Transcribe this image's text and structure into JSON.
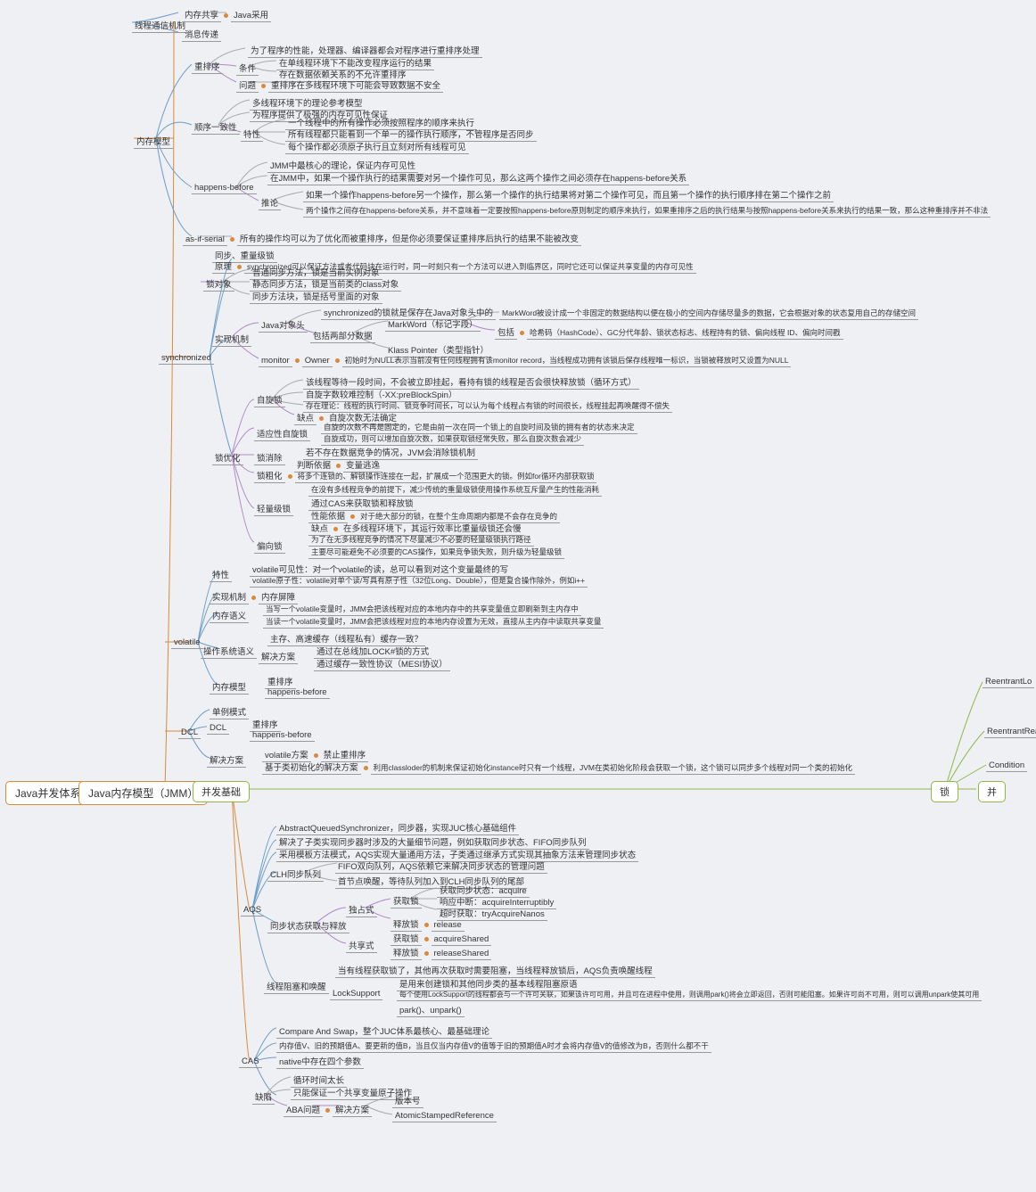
{
  "root": "Java并发体系",
  "jmm": "Java内存模型（JMM）",
  "basic": "并发基础",
  "lock": "锁",
  "tool": "并",
  "reentrant": "ReentrantLo",
  "reentrantRW": "ReentrantRea",
  "condition": "Condition",
  "comm_mech": "线程通信机制",
  "comm_shared": "内存共享",
  "comm_java": "Java采用",
  "comm_msg": "消息传递",
  "mem_model": "内存模型",
  "reorder": "重排序",
  "reorder_desc": "为了程序的性能，处理器、编译器都会对程序进行重排序处理",
  "reorder_cond": "条件",
  "reorder_c1": "在单线程环境下不能改变程序运行的结果",
  "reorder_c2": "存在数据依赖关系的不允许重排序",
  "reorder_prob": "问题",
  "reorder_p1": "重排序在多线程环境下可能会导致数据不安全",
  "seq_consist": "顺序一致性",
  "seq_desc": "多线程环境下的理论参考模型",
  "seq_guarantee": "为程序提供了极强的内存可见性保证",
  "seq_feat": "特性",
  "seq_f1": "一个线程中的所有操作必须按照程序的顺序来执行",
  "seq_f2": "所有线程都只能看到一个单一的操作执行顺序，不管程序是否同步",
  "seq_f3": "每个操作都必须原子执行且立刻对所有线程可见",
  "hb": "happens-before",
  "hb_desc": "JMM中最核心的理论，保证内存可见性",
  "hb_def": "在JMM中，如果一个操作执行的结果需要对另一个操作可见，那么这两个操作之间必须存在happens-before关系",
  "hb_infer": "推论",
  "hb_i1": "如果一个操作happens-before另一个操作，那么第一个操作的执行结果将对第二个操作可见，而且第一个操作的执行顺序排在第二个操作之前",
  "hb_i2": "两个操作之间存在happens-before关系，并不意味着一定要按照happens-before原则制定的顺序来执行，如果重排序之后的执行结果与按照happens-before关系来执行的结果一致，那么这种重排序并不非法",
  "asif": "as-if-serial",
  "asif_desc": "所有的操作均可以为了优化而被重排序，但是你必须要保证重排序后执行的结果不能被改变",
  "sync": "synchronized",
  "sync_level": "同步、重量级锁",
  "sync_princ": "原理",
  "sync_princ_desc": "synchronized可以保证方法或者代码块在运行时，同一时刻只有一个方法可以进入到临界区，同时它还可以保证共享变量的内存可见性",
  "lock_obj": "锁对象",
  "lock_o1": "普通同步方法，锁是当前实例对象",
  "lock_o2": "静态同步方法，锁是当前类的class对象",
  "lock_o3": "同步方法块，锁是括号里面的对象",
  "impl_mech": "实现机制",
  "java_header": "Java对象头",
  "header_desc": "synchronized的锁就是保存在Java对象头中的",
  "header_parts": "包括两部分数据",
  "markword": "MarkWord（标记字段）",
  "mw_desc": "MarkWord被设计成一个非固定的数据结构以便在极小的空间内存储尽量多的数据，它会根据对象的状态复用自己的存储空间",
  "mw_include": "包括",
  "mw_i1": "哈希码（HashCode）、GC分代年龄、锁状态标志、线程持有的锁、偏向线程 ID、偏向时间戳",
  "klass": "Klass Pointer（类型指针）",
  "monitor": "monitor",
  "owner": "Owner",
  "owner_desc": "初始时为NULL表示当前没有任何线程拥有该monitor record，当线程成功拥有该锁后保存线程唯一标识，当锁被释放时又设置为NULL",
  "lock_opt": "锁优化",
  "spin": "自旋锁",
  "spin_desc": "该线程等待一段时间，不会被立即挂起，看持有锁的线程是否会很快释放锁（循环方式）",
  "spin_param": "自旋字数较难控制（-XX:preBlockSpin）",
  "spin_fault": "存在理论：线程的执行时间、锁竞争时间长，可以认为每个线程占有锁的时间很长，线程挂起再唤醒得不偿失",
  "spin_weak": "缺点",
  "spin_w1": "自旋次数无法确定",
  "adapt_spin": "适应性自旋锁",
  "adapt_desc": "自旋的次数不再是固定的，它是由前一次在同一个锁上的自旋时间及锁的拥有者的状态来决定",
  "adapt_succ": "自旋成功，则可以增加自旋次数，如果获取锁经常失败，那么自旋次数会减少",
  "lock_elim": "锁消除",
  "elim_desc": "若不存在数据竞争的情况，JVM会消除锁机制",
  "elim_judge": "判断依据",
  "elim_j1": "变量逃逸",
  "lock_coarse": "锁粗化",
  "coarse_desc": "将多个连锁的、解锁操作连接在一起，扩展成一个范围更大的锁。例如for循环内部获取锁",
  "light_lock": "轻量级锁",
  "light_desc": "在没有多线程竞争的前提下，减少传统的重量级锁使用操作系统互斥量产生的性能消耗",
  "light_cas": "通过CAS来获取锁和释放锁",
  "light_perf": "性能依据",
  "light_p1": "对于绝大部分的锁，在整个生命周期内都是不会存在竞争的",
  "light_weak": "缺点",
  "light_w1": "在多线程环境下，其运行效率比重量级锁还会慢",
  "bias_lock": "偏向锁",
  "bias_desc": "为了在无多线程竞争的情况下尽量减少不必要的轻量级锁执行路径",
  "bias_principle": "主要尽可能避免不必须要的CAS操作，如果竞争锁失败，则升级为轻量级锁",
  "volatile": "volatile",
  "vol_feat": "特性",
  "vol_visible": "volatile可见性：对一个volatile的读，总可以看到对这个变量最终的写",
  "vol_atomic": "volatile原子性：volatile对单个读/写具有原子性（32位Long、Double），但是复合操作除外，例如i++",
  "vol_impl": "实现机制",
  "vol_impl_v": "内存屏障",
  "vol_sem": "内存语义",
  "vol_sem1": "当写一个volatile变量时，JMM会把该线程对应的本地内存中的共享变量值立即刷新到主内存中",
  "vol_sem2": "当读一个volatile变量时，JMM会把该线程对应的本地内存设置为无效，直接从主内存中读取共享变量",
  "vol_op_sem": "操作系统语义",
  "vol_os1": "主存、高速缓存（线程私有）缓存一致？",
  "vol_sol": "解决方案",
  "vol_s1": "通过在总线加LOCK#锁的方式",
  "vol_s2": "通过缓存一致性协议（MESI协议）",
  "vol_mm": "内存模型",
  "vol_mm1": "重排序",
  "vol_mm2": "happens-before",
  "dcl": "DCL",
  "dcl_single": "单例模式",
  "dcl_lbl": "DCL",
  "dcl_reorder": "重排序",
  "dcl_hb": "happens-before",
  "dcl_sol": "解决方案",
  "dcl_vol": "volatile方案",
  "dcl_vol_desc": "禁止重排序",
  "dcl_holder": "基于类初始化的解决方案",
  "dcl_holder_desc": "利用classloder的机制来保证初始化instance时只有一个线程，JVM在类初始化阶段会获取一个锁，这个锁可以同步多个线程对同一个类的初始化",
  "aqs": "AQS",
  "aqs_desc": "AbstractQueuedSynchronizer，同步器，实现JUC核心基础组件",
  "aqs_solve": "解决了子类实现同步器时涉及的大量细节问题，例如获取同步状态、FIFO同步队列",
  "aqs_template": "采用模板方法模式，AQS实现大量通用方法，子类通过继承方式实现其抽象方法来管理同步状态",
  "clh": "CLH同步队列",
  "clh_desc": "FIFO双向队列，AQS依赖它来解决同步状态的管理问题",
  "clh_head": "首节点唤醒，等待队列加入到CLH同步队列的尾部",
  "sync_state": "同步状态获取与释放",
  "exclusive": "独占式",
  "excl_get": "获取锁",
  "excl_g1": "获取同步状态：acquire",
  "excl_g2": "响应中断：acquireInterruptibly",
  "excl_g3": "超时获取：tryAcquireNanos",
  "excl_rel": "释放锁",
  "excl_r1": "release",
  "shared": "共享式",
  "sh_get": "获取锁",
  "sh_g1": "acquireShared",
  "sh_rel": "释放锁",
  "sh_r1": "releaseShared",
  "block_wake": "线程阻塞和唤醒",
  "bw_desc": "当有线程获取锁了，其他再次获取时需要阻塞，当线程释放锁后，AQS负责唤醒线程",
  "locksupport": "LockSupport",
  "ls_desc": "是用来创建锁和其他同步类的基本线程阻塞原语",
  "ls_park": "每个使用LockSupport的线程都会与一个许可关联，如果该许可可用，并且可在进程中使用，则调用park()将会立即返回，否则可能阻塞。如果许可尚不可用，则可以调用unpark使其可用",
  "ls_methods": "park()、unpark()",
  "cas": "CAS",
  "cas_desc": "Compare And Swap，整个JUC体系最核心、最基础理论",
  "cas_mem": "内存值V、旧的预期值A、要更新的值B，当且仅当内存值V的值等于旧的预期值A时才会将内存值V的值修改为B，否则什么都不干",
  "cas_native": "native中存在四个参数",
  "cas_weak": "缺陷",
  "cas_w1": "循环时间太长",
  "cas_w2": "只能保证一个共享变量原子操作",
  "cas_aba": "ABA问题",
  "cas_aba_sol": "解决方案",
  "cas_aba_s1": "版本号",
  "cas_aba_s2": "AtomicStampedReference"
}
